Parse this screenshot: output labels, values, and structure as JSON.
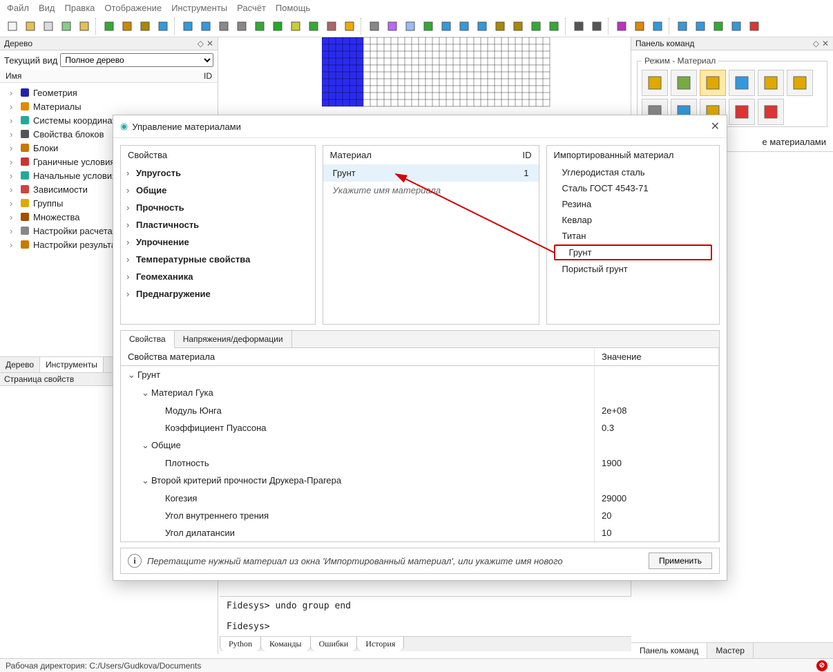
{
  "menu": [
    "Файл",
    "Вид",
    "Правка",
    "Отображение",
    "Инструменты",
    "Расчёт",
    "Помощь"
  ],
  "left_panel": {
    "title": "Дерево",
    "view_label": "Текущий вид",
    "view_value": "Полное дерево",
    "col_name": "Имя",
    "col_id": "ID",
    "items": [
      {
        "label": "Геометрия",
        "icon": "#22a",
        "shape": "cube"
      },
      {
        "label": "Материалы",
        "icon": "#e08a00",
        "shape": "palette"
      },
      {
        "label": "Системы координат",
        "icon": "#2a9",
        "shape": "axes"
      },
      {
        "label": "Свойства блоков",
        "icon": "#555",
        "shape": "ibeam"
      },
      {
        "label": "Блоки",
        "icon": "#c77a00",
        "shape": "brick"
      },
      {
        "label": "Граничные условия",
        "icon": "#c33",
        "shape": "flag"
      },
      {
        "label": "Начальные условия",
        "icon": "#2a9",
        "shape": "axes"
      },
      {
        "label": "Зависимости",
        "icon": "#c44",
        "shape": "wave"
      },
      {
        "label": "Группы",
        "icon": "#e0a800",
        "shape": "layers"
      },
      {
        "label": "Множества",
        "icon": "#a05000",
        "shape": "stack"
      },
      {
        "label": "Настройки расчета",
        "icon": "#888",
        "shape": "gear"
      },
      {
        "label": "Настройки результатов",
        "icon": "#c77a00",
        "shape": "disc"
      }
    ],
    "tabs": [
      "Дерево",
      "Инструменты"
    ],
    "prop_title": "Страница свойств"
  },
  "right_panel": {
    "title": "Панель команд",
    "mode_legend": "Режим - Материал",
    "sub_label": "е материалами"
  },
  "dialog": {
    "title": "Управление материалами",
    "props_header": "Свойства",
    "props": [
      "Упругость",
      "Общие",
      "Прочность",
      "Пластичность",
      "Упрочнение",
      "Температурные свойства",
      "Геомеханика",
      "Преднагружение"
    ],
    "mat_header": "Материал",
    "mat_id_header": "ID",
    "material_name": "Грунт",
    "material_id": "1",
    "mat_placeholder": "Укажите имя материала",
    "imp_header": "Импортированный материал",
    "imported": [
      "Углеродистая сталь",
      "Сталь ГОСТ 4543-71",
      "Резина",
      "Кевлар",
      "Титан",
      "Грунт",
      "Пористый грунт"
    ],
    "tabs": [
      "Свойства",
      "Напряжения/деформации"
    ],
    "grid_headers": [
      "Свойства материала",
      "Значение"
    ],
    "grid_rows": [
      {
        "label": "Грунт",
        "lvl": 0,
        "exp": true,
        "val": ""
      },
      {
        "label": "Материал Гука",
        "lvl": 1,
        "exp": true,
        "val": ""
      },
      {
        "label": "Модуль Юнга",
        "lvl": 2,
        "val": "2e+08"
      },
      {
        "label": "Коэффициент Пуассона",
        "lvl": 2,
        "val": "0.3"
      },
      {
        "label": "Общие",
        "lvl": 1,
        "exp": true,
        "val": ""
      },
      {
        "label": "Плотность",
        "lvl": 2,
        "val": "1900"
      },
      {
        "label": "Второй критерий прочности Друкера-Прагера",
        "lvl": 1,
        "exp": true,
        "val": ""
      },
      {
        "label": "Когезия",
        "lvl": 2,
        "val": "29000"
      },
      {
        "label": "Угол внутреннего трения",
        "lvl": 2,
        "val": "20"
      },
      {
        "label": "Угол дилатансии",
        "lvl": 2,
        "val": "10"
      }
    ],
    "hint": "Перетащите нужный материал из окна 'Импортированный материал', или укажите имя нового",
    "apply": "Применить"
  },
  "console": {
    "lines": [
      "Fidesys> undo group end",
      "",
      "Fidesys>"
    ],
    "tabs": [
      "Python",
      "Команды",
      "Ошибки",
      "История"
    ]
  },
  "right_tabs": [
    "Панель команд",
    "Мастер"
  ],
  "status": "Рабочая директория: C:/Users/Gudkova/Documents"
}
